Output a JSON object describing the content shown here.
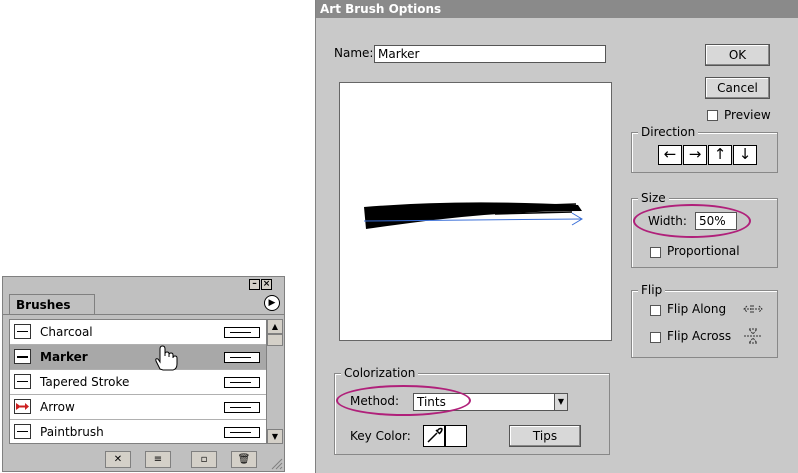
{
  "brushes_panel": {
    "tab_label": "Brushes",
    "items": [
      {
        "label": "Charcoal",
        "selected": false
      },
      {
        "label": "Marker",
        "selected": true
      },
      {
        "label": "Tapered Stroke",
        "selected": false
      },
      {
        "label": "Arrow",
        "selected": false
      },
      {
        "label": "Paintbrush",
        "selected": false
      }
    ]
  },
  "dialog": {
    "title": "Art Brush Options",
    "name_label": "Name:",
    "name_value": "Marker",
    "ok_label": "OK",
    "cancel_label": "Cancel",
    "preview_label": "Preview",
    "direction": {
      "title": "Direction",
      "arrows": [
        "←",
        "→",
        "↑",
        "↓"
      ]
    },
    "size": {
      "title": "Size",
      "width_label": "Width:",
      "width_value": "50%",
      "proportional_label": "Proportional"
    },
    "flip": {
      "title": "Flip",
      "flip_along_label": "Flip Along",
      "flip_across_label": "Flip Across"
    },
    "colorization": {
      "title": "Colorization",
      "method_label": "Method:",
      "method_value": "Tints",
      "key_color_label": "Key Color:",
      "tips_label": "Tips"
    }
  },
  "colors": {
    "highlight_oval": "#b0207a",
    "arrow_brush": "#cc2020",
    "stroke_guide": "#3a6fd8"
  }
}
